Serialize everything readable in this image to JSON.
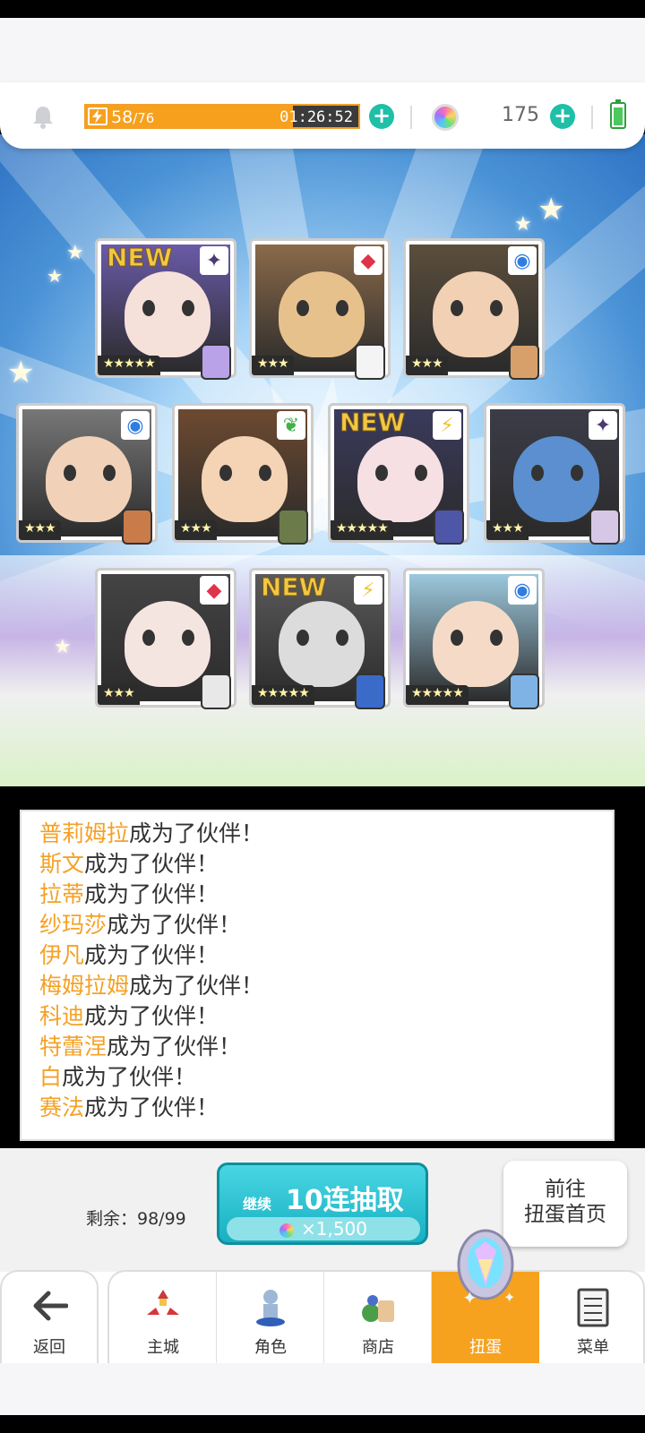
{
  "hud": {
    "stamina_current": "58",
    "stamina_max": "/76",
    "stamina_fraction": 0.76,
    "stamina_timer": "01:26:52",
    "gem_count": "175"
  },
  "cards": [
    {
      "rarity": "★★★★★",
      "new": "NEW",
      "element": "✦",
      "element_color": "#4b3a73",
      "art_color": "#6a5aa8",
      "face_color": "#f6e0da",
      "sprite_color": "#b9a2e8"
    },
    {
      "rarity": "★★★",
      "new": "",
      "element": "◆",
      "element_color": "#e0334a",
      "art_color": "#8a6a4a",
      "face_color": "#e7c18c",
      "sprite_color": "#f4f4f4"
    },
    {
      "rarity": "★★★",
      "new": "",
      "element": "◉",
      "element_color": "#2f7de1",
      "art_color": "#5b4e3c",
      "face_color": "#f2d0b4",
      "sprite_color": "#d7a06b"
    },
    {
      "rarity": "★★★",
      "new": "",
      "element": "◉",
      "element_color": "#2f7de1",
      "art_color": "#777",
      "face_color": "#f1d2b9",
      "sprite_color": "#c97b4a"
    },
    {
      "rarity": "★★★",
      "new": "",
      "element": "❦",
      "element_color": "#3fb24a",
      "art_color": "#6d4a30",
      "face_color": "#f4d4b4",
      "sprite_color": "#6b7c4a"
    },
    {
      "rarity": "★★★★★",
      "new": "NEW",
      "element": "⚡",
      "element_color": "#f2c32c",
      "art_color": "#3a3a5c",
      "face_color": "#f6e0e4",
      "sprite_color": "#4e56a8"
    },
    {
      "rarity": "★★★",
      "new": "",
      "element": "✦",
      "element_color": "#4b3a73",
      "art_color": "#3c3c48",
      "face_color": "#5b8fcf",
      "sprite_color": "#d7c7e6"
    },
    {
      "rarity": "★★★",
      "new": "",
      "element": "◆",
      "element_color": "#e0334a",
      "art_color": "#444",
      "face_color": "#f5e5e0",
      "sprite_color": "#e8e8e8"
    },
    {
      "rarity": "★★★★★",
      "new": "NEW",
      "element": "⚡",
      "element_color": "#f2c32c",
      "art_color": "#5a5a5a",
      "face_color": "#dcdcdc",
      "sprite_color": "#3b6bc9"
    },
    {
      "rarity": "★★★★★",
      "new": "",
      "element": "◉",
      "element_color": "#2f7de1",
      "art_color": "#9cc8dd",
      "face_color": "#f5dbc7",
      "sprite_color": "#7fb3e6"
    }
  ],
  "log": [
    {
      "name": "普莉姆拉",
      "text": "成为了伙伴！"
    },
    {
      "name": "斯文",
      "text": "成为了伙伴！"
    },
    {
      "name": "拉蒂",
      "text": "成为了伙伴！"
    },
    {
      "name": "纱玛莎",
      "text": "成为了伙伴！"
    },
    {
      "name": "伊凡",
      "text": "成为了伙伴！"
    },
    {
      "name": "梅姆拉姆",
      "text": "成为了伙伴！"
    },
    {
      "name": "科迪",
      "text": "成为了伙伴！"
    },
    {
      "name": "特蕾涅",
      "text": "成为了伙伴！"
    },
    {
      "name": "白",
      "text": "成为了伙伴！"
    },
    {
      "name": "赛法",
      "text": "成为了伙伴！"
    }
  ],
  "actions": {
    "remaining_label": "剩余：98/99",
    "pull_continue": "继续",
    "pull_main": "10连抽取",
    "pull_cost": "×1,500",
    "home_line1": "前往",
    "home_line2": "扭蛋首页"
  },
  "nav": {
    "back": "返回",
    "tabs": [
      "主城",
      "角色",
      "商店",
      "扭蛋",
      "菜单"
    ],
    "active": "扭蛋",
    "accent": "#f6a21f"
  }
}
